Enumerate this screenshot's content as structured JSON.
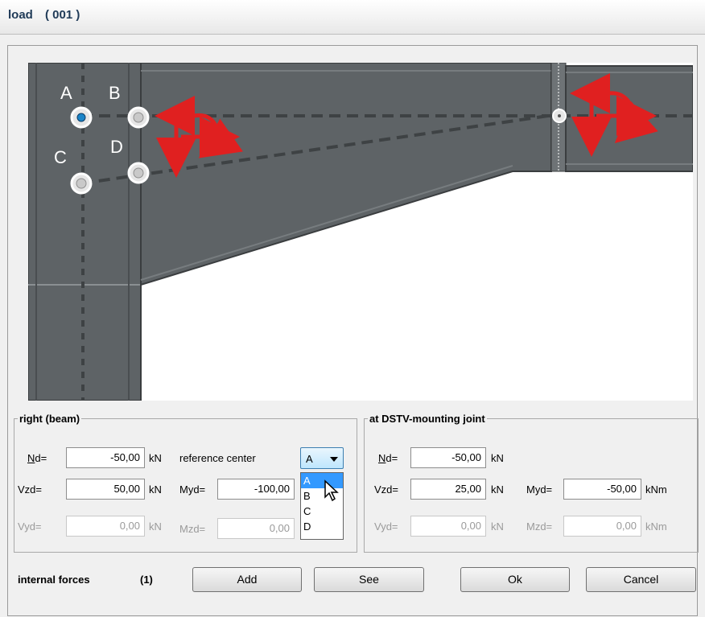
{
  "window": {
    "title": "load",
    "number": "( 001 )"
  },
  "drawing": {
    "point_labels": [
      "A",
      "B",
      "C",
      "D"
    ],
    "colors": {
      "steel": "#5e6366",
      "background": "#ffffff",
      "arrows": "#e02020"
    }
  },
  "right_group": {
    "legend": "right (beam)",
    "nd_label_u": "N",
    "nd_label_rest": "d=",
    "nd_value": "-50,00",
    "nd_unit": "kN",
    "ref_label": "reference center",
    "ref_selected": "A",
    "ref_options": [
      "A",
      "B",
      "C",
      "D"
    ],
    "vzd_label": "Vzd=",
    "vzd_value": "50,00",
    "vzd_unit": "kN",
    "myd_label": "Myd=",
    "myd_value": "-100,00",
    "vyd_label": "Vyd=",
    "vyd_value": "0,00",
    "vyd_unit": "kN",
    "mzd_label": "Mzd=",
    "mzd_value": "0,00"
  },
  "joint_group": {
    "legend": "at DSTV-mounting joint",
    "nd_label_u": "N",
    "nd_label_rest": "d=",
    "nd_value": "-50,00",
    "nd_unit": "kN",
    "vzd_label": "Vzd=",
    "vzd_value": "25,00",
    "vzd_unit": "kN",
    "myd_label": "Myd=",
    "myd_value": "-50,00",
    "myd_unit": "kNm",
    "vyd_label": "Vyd=",
    "vyd_value": "0,00",
    "vyd_unit": "kN",
    "mzd_label": "Mzd=",
    "mzd_value": "0,00",
    "mzd_unit": "kNm"
  },
  "footer": {
    "internal_forces_label": "internal forces",
    "internal_forces_count": "(1)",
    "add_label": "Add",
    "see_label": "See",
    "ok_label": "Ok",
    "cancel_label": "Cancel"
  }
}
